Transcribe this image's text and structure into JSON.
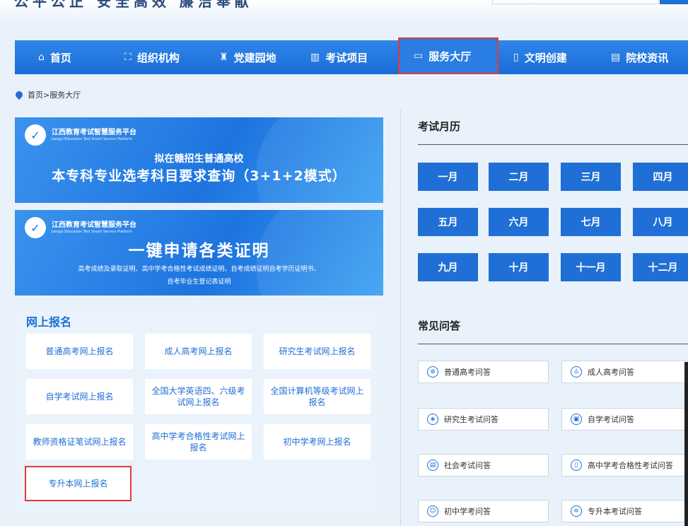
{
  "header": {
    "slogan": "公平公正 安全高效 廉洁奉献"
  },
  "nav": {
    "items": [
      {
        "icon": "⌂",
        "label": "首页"
      },
      {
        "icon": "⛶",
        "label": "组织机构"
      },
      {
        "icon": "♜",
        "label": "党建园地"
      },
      {
        "icon": "▥",
        "label": "考试项目"
      },
      {
        "icon": "▭",
        "label": "服务大厅"
      },
      {
        "icon": "▯",
        "label": "文明创建"
      },
      {
        "icon": "▤",
        "label": "院校资讯"
      }
    ],
    "active_index": 4
  },
  "breadcrumb": {
    "text": "首页>服务大厅"
  },
  "banner1": {
    "logo_cn": "江西教育考试智慧服务平台",
    "logo_en": "Jiangxi Education Test Smart Service Platform",
    "sub": "拟在赣招生普通高校",
    "main": "本专科专业选考科目要求查询（3+1+2模式）"
  },
  "banner2": {
    "logo_cn": "江西教育考试智慧服务平台",
    "logo_en": "Jiangxi Education Test Smart Service Platform",
    "main": "一键申请各类证明",
    "line1": "高考成绩及录取证明、高中学考合格性考试成绩证明、自考成绩证明自考学历证明书、",
    "line2": "自考毕业生登记表证明"
  },
  "online_registration": {
    "title": "网上报名",
    "items": [
      "普通高考网上报名",
      "成人高考网上报名",
      "研究生考试网上报名",
      "自学考试网上报名",
      "全国大学英语四、六级考试网上报名",
      "全国计算机等级考试网上报名",
      "教师资格证笔试网上报名",
      "高中学考合格性考试网上报名",
      "初中学考网上报名",
      "专升本网上报名"
    ]
  },
  "calendar": {
    "title": "考试月历",
    "months": [
      "一月",
      "二月",
      "三月",
      "四月",
      "五月",
      "六月",
      "七月",
      "八月",
      "九月",
      "十月",
      "十一月",
      "十二月"
    ]
  },
  "faq": {
    "title": "常见问答",
    "items": [
      {
        "icon": "⊕",
        "label": "普通高考问答"
      },
      {
        "icon": "♙",
        "label": "成人高考问答"
      },
      {
        "icon": "◈",
        "label": "研究生考试问答"
      },
      {
        "icon": "▣",
        "label": "自学考试问答"
      },
      {
        "icon": "▤",
        "label": "社会考试问答"
      },
      {
        "icon": "▯",
        "label": "高中学考合格性考试问答"
      },
      {
        "icon": "☺",
        "label": "初中学考问答"
      },
      {
        "icon": "≡",
        "label": "专升本考试问答"
      }
    ]
  },
  "colors": {
    "primary": "#1f6fd6",
    "highlight": "#e03a3a",
    "panel_bg": "#eaf3fc"
  }
}
